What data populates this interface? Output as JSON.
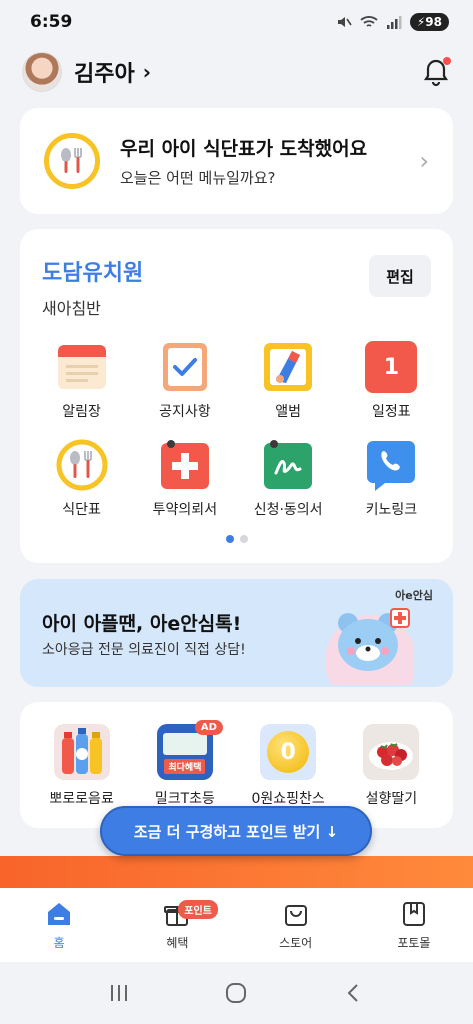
{
  "status_bar": {
    "time": "6:59",
    "battery": "98"
  },
  "header": {
    "user_name": "김주아",
    "chevron": "›"
  },
  "meal_card": {
    "title": "우리 아이 식단표가 도착했어요",
    "subtitle": "오늘은 어떤 메뉴일까요?",
    "arrow": "›"
  },
  "school": {
    "name": "도담유치원",
    "class_name": "새아침반",
    "edit_label": "편집",
    "menu": [
      {
        "label": "알림장",
        "icon": "notebook-icon"
      },
      {
        "label": "공지사항",
        "icon": "checklist-icon"
      },
      {
        "label": "앨범",
        "icon": "album-icon"
      },
      {
        "label": "일정표",
        "icon": "calendar-icon"
      },
      {
        "label": "식단표",
        "icon": "meal-icon"
      },
      {
        "label": "투약의뢰서",
        "icon": "medicine-icon"
      },
      {
        "label": "신청·동의서",
        "icon": "consent-icon"
      },
      {
        "label": "키노링크",
        "icon": "phone-icon"
      }
    ],
    "calendar_day": "1"
  },
  "banner": {
    "title": "아이 아플땐, 아e안심톡!",
    "subtitle": "소아응급 전문 의료진이 직접 상담!",
    "logo": "아e안심"
  },
  "shop": {
    "items": [
      {
        "label": "뽀로로음료"
      },
      {
        "label": "밀크T초등",
        "badge": "AD",
        "thumb_text": "최다혜택"
      },
      {
        "label": "0원쇼핑찬스",
        "thumb_text": "0"
      },
      {
        "label": "설향딸기"
      }
    ]
  },
  "cta": {
    "label": "조금 더 구경하고 포인트 받기 ↓"
  },
  "tabbar": {
    "tabs": [
      {
        "label": "홈",
        "icon": "home-icon",
        "active": true
      },
      {
        "label": "혜택",
        "icon": "gift-icon",
        "badge": "포인트"
      },
      {
        "label": "스토어",
        "icon": "shopping-bag-icon"
      },
      {
        "label": "포토몰",
        "icon": "photobook-icon"
      }
    ]
  },
  "colors": {
    "accent": "#3e7ee4",
    "badge": "#f05a4b",
    "banner_bg": "#d5e7fb",
    "meal_ring": "#f7c325"
  }
}
